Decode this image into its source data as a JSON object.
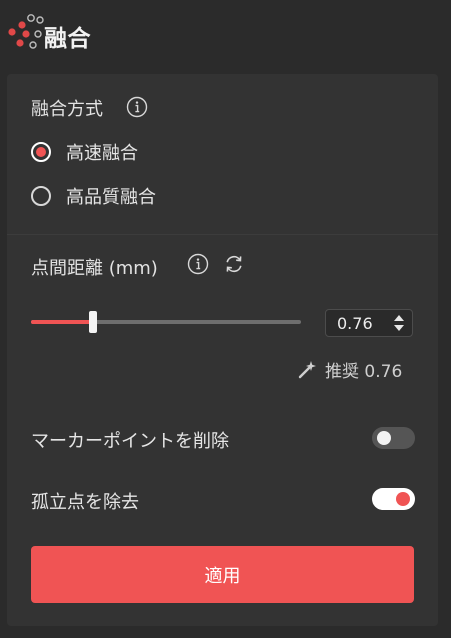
{
  "header": {
    "title": "融合",
    "logo_icon": "fusion-dots-logo"
  },
  "fusion_method": {
    "label": "融合方式",
    "info_icon": "info-icon",
    "options": [
      {
        "label": "高速融合",
        "selected": true
      },
      {
        "label": "高品質融合",
        "selected": false
      }
    ]
  },
  "point_spacing": {
    "label": "点間距離 (mm)",
    "info_icon": "info-icon",
    "reset_icon": "refresh-icon",
    "slider_fraction": 0.23,
    "value": "0.76",
    "recommend_icon": "magic-wand-icon",
    "recommend_text": "推奨 0.76"
  },
  "options": {
    "remove_markers": {
      "label": "マーカーポイントを削除",
      "enabled": false
    },
    "remove_isolated": {
      "label": "孤立点を除去",
      "enabled": true
    }
  },
  "apply_button": {
    "label": "適用"
  },
  "colors": {
    "accent": "#f05454",
    "panel": "#333333",
    "background": "#2b2b2b"
  }
}
